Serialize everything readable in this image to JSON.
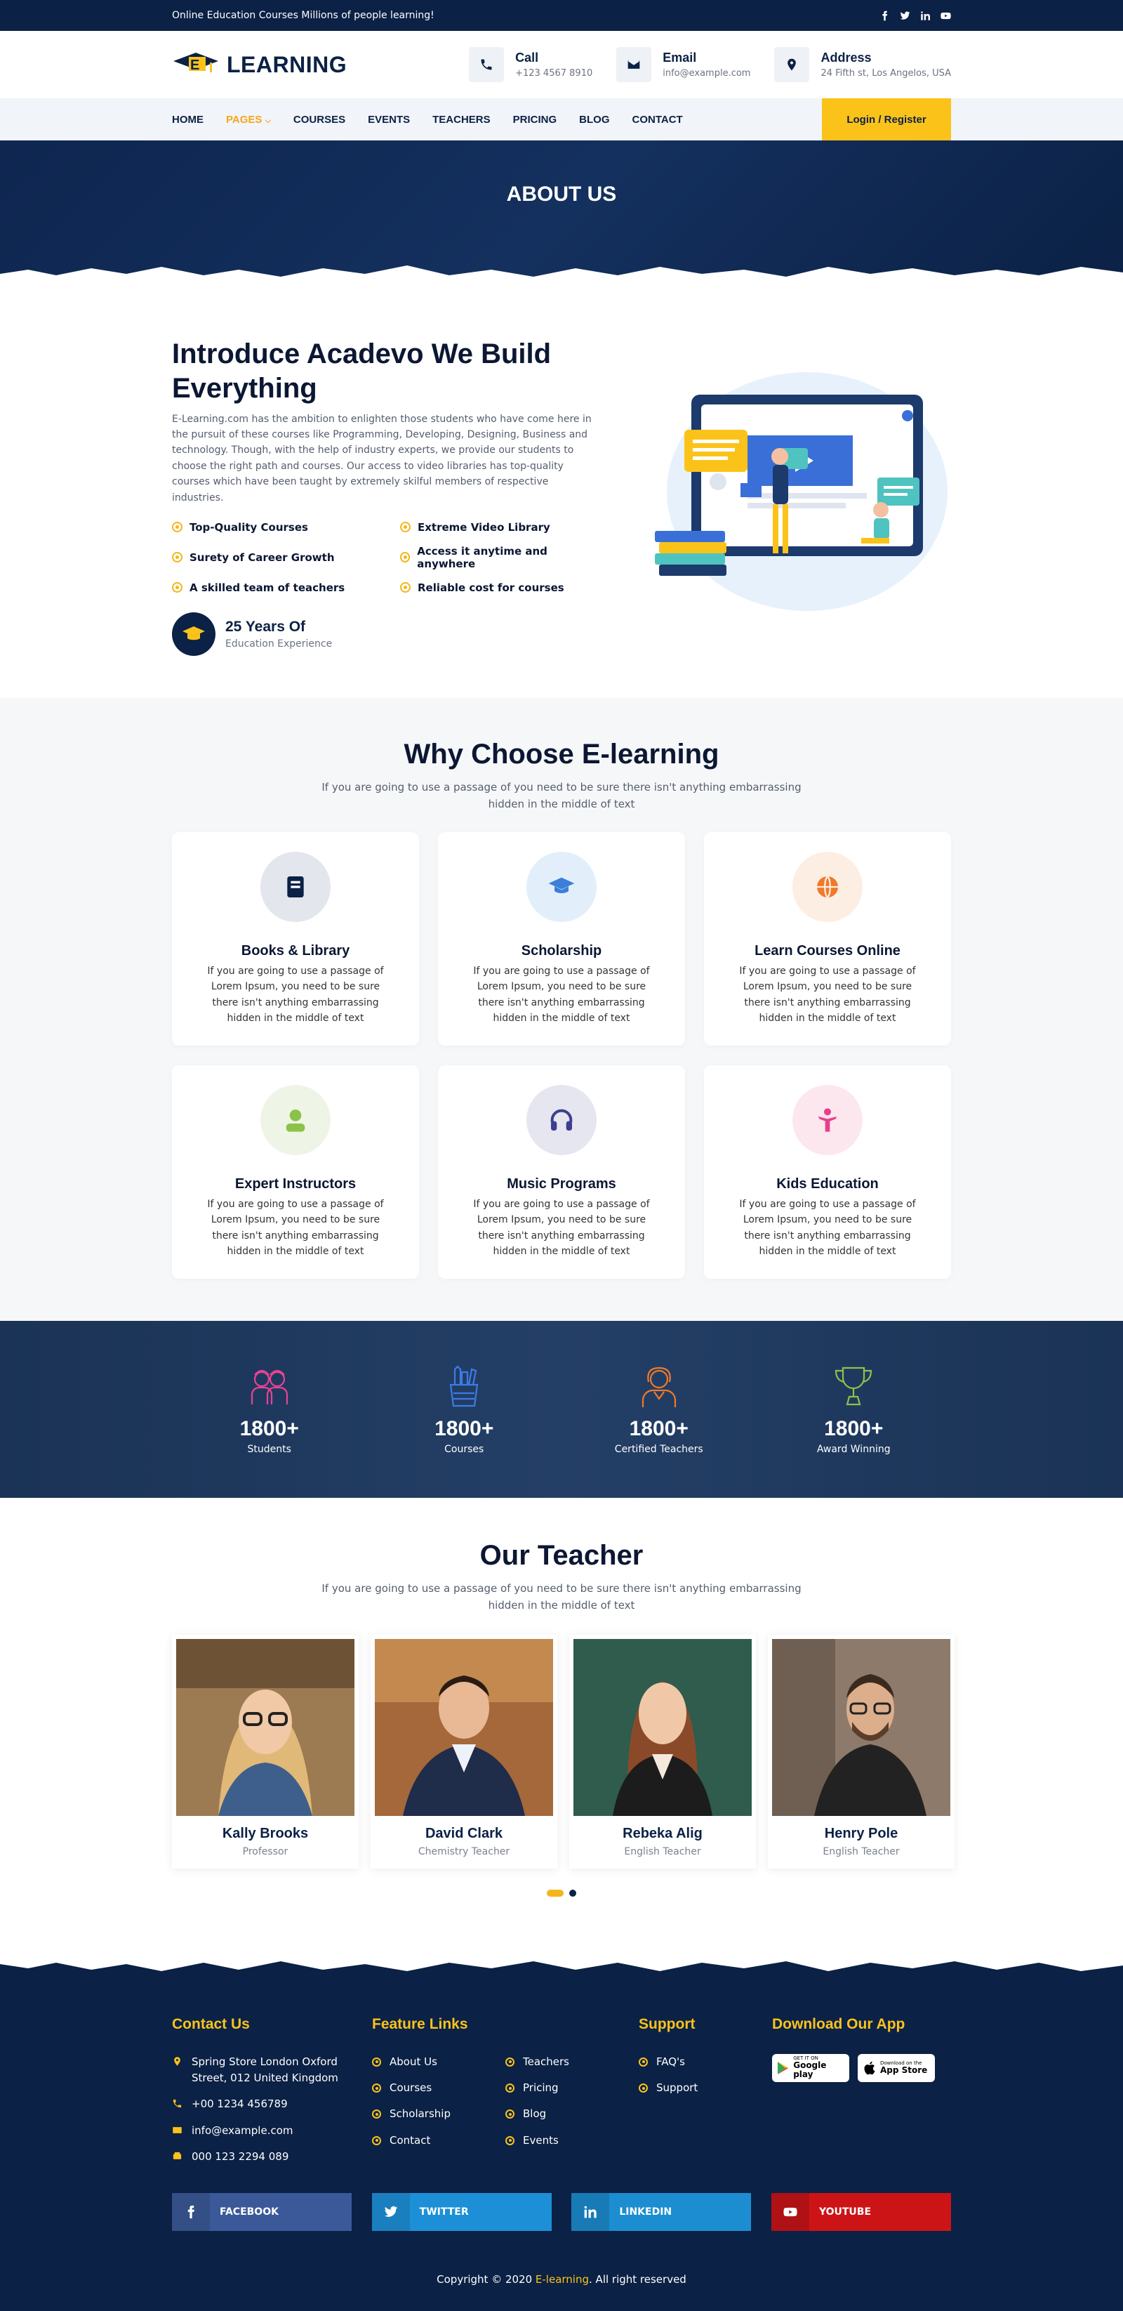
{
  "topbar": {
    "tagline": "Online Education Courses Millions of people learning!",
    "social_icons": [
      "facebook-icon",
      "twitter-icon",
      "linkedin-icon",
      "youtube-icon"
    ]
  },
  "header": {
    "logo_text": "LEARNING",
    "logo_letter": "E",
    "contacts": [
      {
        "title": "Call",
        "value": "+123 4567 8910",
        "icon": "phone-icon"
      },
      {
        "title": "Email",
        "value": "info@example.com",
        "icon": "envelope-icon"
      },
      {
        "title": "Address",
        "value": "24 Fifth st, Los Angelos, USA",
        "icon": "map-pin-icon"
      }
    ]
  },
  "nav": {
    "items": [
      "HOME",
      "PAGES",
      "COURSES",
      "EVENTS",
      "TEACHERS",
      "PRICING",
      "BLOG",
      "CONTACT"
    ],
    "active_index": 1,
    "login_label": "Login / Register"
  },
  "hero": {
    "title": "ABOUT US"
  },
  "about": {
    "heading": "Introduce Acadevo We Build Everything",
    "description": "E-Learning.com has the ambition to enlighten those students who have come here in the pursuit of these courses like Programming, Developing, Designing, Business and technology. Though, with the help of industry experts, we provide our students to choose the right path and courses. Our access to video libraries has top-quality courses which have been taught by extremely skilful members of respective industries.",
    "features": [
      "Top-Quality Courses",
      "Extreme Video Library",
      "Surety of Career Growth",
      "Access it anytime and anywhere",
      "A skilled team of teachers",
      "Reliable cost for courses"
    ],
    "years_title": "25 Years Of",
    "years_sub": "Education Experience"
  },
  "why": {
    "title": "Why Choose E-learning",
    "subtitle": "If you are going to use a passage of you need to be sure there isn't anything embarrassing hidden in the middle of text",
    "cards": [
      {
        "title": "Books & Library",
        "text": "If you are going to use a passage of Lorem Ipsum, you need to be sure there isn't anything embarrassing hidden in the middle of text",
        "icon": "book-icon",
        "bg": "#e3e6ec",
        "color": "#0b2145"
      },
      {
        "title": "Scholarship",
        "text": "If you are going to use a passage of Lorem Ipsum, you need to be sure there isn't anything embarrassing hidden in the middle of text",
        "icon": "graduation-cap-icon",
        "bg": "#e2effb",
        "color": "#3b7fd9"
      },
      {
        "title": "Learn Courses Online",
        "text": "If you are going to use a passage of Lorem Ipsum, you need to be sure there isn't anything embarrassing hidden in the middle of text",
        "icon": "globe-icon",
        "bg": "#fdeee3",
        "color": "#f07a2a"
      },
      {
        "title": "Expert Instructors",
        "text": "If you are going to use a passage of Lorem Ipsum, you need to be sure there isn't anything embarrassing hidden in the middle of text",
        "icon": "user-icon",
        "bg": "#eef5e6",
        "color": "#8bc34a"
      },
      {
        "title": "Music Programs",
        "text": "If you are going to use a passage of Lorem Ipsum, you need to be sure there isn't anything embarrassing hidden in the middle of text",
        "icon": "headphones-icon",
        "bg": "#e6e6f0",
        "color": "#3c3f8f"
      },
      {
        "title": "Kids Education",
        "text": "If you are going to use a passage of Lorem Ipsum, you need to be sure there isn't anything embarrassing hidden in the middle of text",
        "icon": "child-icon",
        "bg": "#fde7ef",
        "color": "#e83e8c"
      }
    ]
  },
  "stats": [
    {
      "number": "1800+",
      "label": "Students",
      "icon": "students-icon",
      "color": "#e84393"
    },
    {
      "number": "1800+",
      "label": "Courses",
      "icon": "pencil-cup-icon",
      "color": "#3d7be8"
    },
    {
      "number": "1800+",
      "label": "Certified Teachers",
      "icon": "teacher-icon",
      "color": "#f07a2a"
    },
    {
      "number": "1800+",
      "label": "Award Winning",
      "icon": "trophy-icon",
      "color": "#8bc34a"
    }
  ],
  "teachers": {
    "title": "Our Teacher",
    "subtitle": "If you are going to use a passage of you need to be sure there isn't anything embarrassing hidden in the middle of text",
    "items": [
      {
        "name": "Kally Brooks",
        "role": "Professor"
      },
      {
        "name": "David Clark",
        "role": "Chemistry Teacher"
      },
      {
        "name": "Rebeka Alig",
        "role": "English Teacher"
      },
      {
        "name": "Henry Pole",
        "role": "English Teacher"
      }
    ]
  },
  "footer": {
    "contact_title": "Contact Us",
    "address": "Spring Store London Oxford Street, 012 United Kingdom",
    "phone": "+00 1234 456789",
    "email": "info@example.com",
    "fax": "000 123 2294 089",
    "feature_title": "Feature Links",
    "feature_col1": [
      "About Us",
      "Courses",
      "Scholarship",
      "Contact"
    ],
    "feature_col2": [
      "Teachers",
      "Pricing",
      "Blog",
      "Events"
    ],
    "support_title": "Support",
    "support_links": [
      "FAQ's",
      "Support"
    ],
    "app_title": "Download Our App",
    "google_small": "GET IT ON",
    "google_big": "Google play",
    "apple_small": "Download on the",
    "apple_big": "App Store",
    "socials": [
      {
        "label": "FACEBOOK",
        "color": "#3b5998",
        "iconbg": "#344e86",
        "icon": "facebook-icon"
      },
      {
        "label": "TWITTER",
        "color": "#1d8fd6",
        "iconbg": "#1a7fbe",
        "icon": "twitter-icon"
      },
      {
        "label": "LINKEDIN",
        "color": "#1c8dd0",
        "iconbg": "#187bb6",
        "icon": "linkedin-icon"
      },
      {
        "label": "YOUTUBE",
        "color": "#cc1417",
        "iconbg": "#b01114",
        "icon": "youtube-icon"
      }
    ],
    "copyright_pre": "Copyright © 2020 ",
    "copyright_brand": "E-learning",
    "copyright_post": ". All right reserved"
  }
}
